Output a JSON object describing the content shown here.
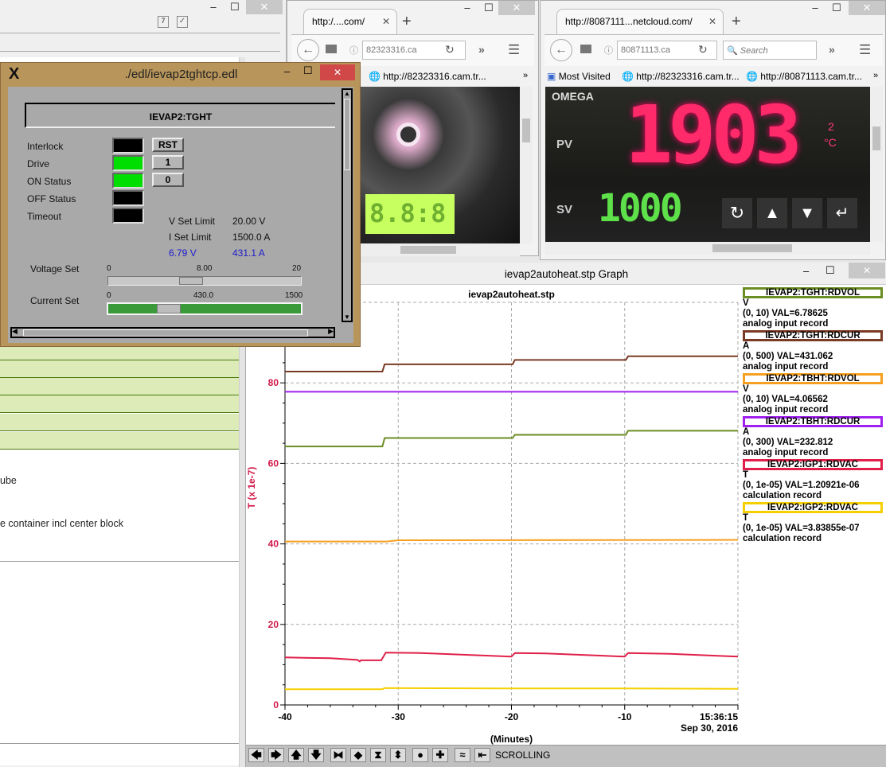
{
  "left_window": {
    "text_line_1": "ube",
    "text_line_2": "e container incl center block",
    "icons": [
      "calendar-icon",
      "task-check-icon"
    ]
  },
  "browser1": {
    "tab_title": "http:/....com/",
    "url": "82323316.ca",
    "bookmark": "http://82323316.cam.tr...",
    "overflow": "»",
    "lcd_text": "8.8:8"
  },
  "browser2": {
    "tab_title": "http://8087111...netcloud.com/",
    "url": "80871113.ca",
    "search_placeholder": "Search",
    "bookmarks": [
      "Most Visited",
      "http://82323316.cam.tr...",
      "http://80871113.cam.tr..."
    ],
    "overflow": "»",
    "display": {
      "brand": "OMEGA",
      "pv_label": "PV",
      "pv_value": "1903",
      "sv_label": "SV",
      "sv_value": "1000",
      "unit": "°C",
      "unit_index": "2"
    }
  },
  "edl": {
    "title": "./edl/ievap2tghtcp.edl",
    "header": "IEVAP2:TGHT",
    "indicators": [
      {
        "label": "Interlock",
        "color": "#000000"
      },
      {
        "label": "Drive",
        "color": "#00dd00"
      },
      {
        "label": "ON Status",
        "color": "#00dd00"
      },
      {
        "label": "OFF Status",
        "color": "#000000"
      },
      {
        "label": "Timeout",
        "color": "#000000"
      }
    ],
    "buttons": [
      "RST",
      "1",
      "0"
    ],
    "v_set_limit_label": "V Set Limit",
    "v_set_limit": "20.00 V",
    "i_set_limit_label": "I Set Limit",
    "i_set_limit": "1500.0 A",
    "v_readback": "6.79 V",
    "i_readback": "431.1 A",
    "voltage_set": {
      "label": "Voltage Set",
      "min": "0",
      "value": "8.00",
      "max": "20",
      "fraction": 0.4
    },
    "current_set": {
      "label": "Current Set",
      "min": "0",
      "value": "430.0",
      "max": "1500",
      "fraction": 0.287
    }
  },
  "graph": {
    "window_title": "ievap2autoheat.stp Graph",
    "status": "SCROLLING",
    "legend": [
      {
        "name": "IEVAP2:TGHT:RDVOL",
        "unit": "V",
        "range": "(0, 10) VAL=6.78625",
        "type": "analog input record",
        "color": "#6b8e23"
      },
      {
        "name": "IEVAP2:TGHT:RDCUR",
        "unit": "A",
        "range": "(0, 500) VAL=431.062",
        "type": "analog input record",
        "color": "#7a3b25"
      },
      {
        "name": "IEVAP2:TBHT:RDVOL",
        "unit": "V",
        "range": "(0, 10) VAL=4.06562",
        "type": "analog input record",
        "color": "#f5a020"
      },
      {
        "name": "IEVAP2:TBHT:RDCUR",
        "unit": "A",
        "range": "(0, 300) VAL=232.812",
        "type": "analog input record",
        "color": "#a020f0"
      },
      {
        "name": "IEVAP2:IGP1:RDVAC",
        "unit": "T",
        "range": "(0, 1e-05) VAL=1.20921e-06",
        "type": "calculation record",
        "color": "#e0204a"
      },
      {
        "name": "IEVAP2:IGP2:RDVAC",
        "unit": "T",
        "range": "(0, 1e-05) VAL=3.83855e-07",
        "type": "calculation record",
        "color": "#f5d000"
      }
    ],
    "toolbar_icons": [
      "pan-left-icon",
      "pan-right-icon",
      "pan-up-icon",
      "pan-down-icon",
      "zoom-in-x-icon",
      "zoom-out-x-icon",
      "zoom-in-y-icon",
      "zoom-out-y-icon",
      "reset-icon",
      "add-icon",
      "autoscale-icon",
      "scroll-end-icon"
    ]
  },
  "chart_data": {
    "type": "line",
    "title": "ievap2autoheat.stp",
    "xlabel": "(Minutes)",
    "ylabel": "T (x 1e-7)",
    "xlim": [
      -40,
      0
    ],
    "ylim": [
      0,
      100
    ],
    "xticks": [
      "-40",
      "-30",
      "-20",
      "-10"
    ],
    "xend_label": [
      "15:36:15",
      "Sep 30, 2016"
    ],
    "yticks": [
      "0",
      "20",
      "40",
      "60",
      "80"
    ],
    "grid": true,
    "legend_placement": "right",
    "series": [
      {
        "name": "IEVAP2:TGHT:RDVOL",
        "color": "#6b8e23",
        "x": [
          -40,
          -31.4,
          -31.2,
          -19.9,
          -19.7,
          -9.9,
          -9.7,
          0
        ],
        "y": [
          64.2,
          64.2,
          66.3,
          66.3,
          67.1,
          67.1,
          68.1,
          68.1
        ]
      },
      {
        "name": "IEVAP2:TGHT:RDCUR",
        "color": "#7a3b25",
        "x": [
          -40,
          -31.4,
          -31.2,
          -19.9,
          -19.7,
          -9.9,
          -9.7,
          0
        ],
        "y": [
          82.8,
          82.8,
          84.6,
          84.6,
          85.7,
          85.7,
          86.6,
          86.6
        ]
      },
      {
        "name": "IEVAP2:TBHT:RDVOL",
        "color": "#f5a020",
        "x": [
          -40,
          -31,
          -30,
          0
        ],
        "y": [
          40.6,
          40.6,
          40.9,
          41.0
        ]
      },
      {
        "name": "IEVAP2:TBHT:RDCUR",
        "color": "#a020f0",
        "x": [
          -40,
          0
        ],
        "y": [
          77.8,
          77.8
        ]
      },
      {
        "name": "IEVAP2:IGP1:RDVAC",
        "color": "#e0204a",
        "x": [
          -40,
          -36,
          -33.6,
          -33.4,
          -33.3,
          -31.5,
          -31.1,
          -28,
          -20,
          -19.7,
          -17,
          -10,
          -9.7,
          -6,
          0
        ],
        "y": [
          11.8,
          11.6,
          11.2,
          10.8,
          11.1,
          11.1,
          13.0,
          12.9,
          12.0,
          12.9,
          12.8,
          12.0,
          12.9,
          12.7,
          12.0
        ]
      },
      {
        "name": "IEVAP2:IGP2:RDVAC",
        "color": "#f5d000",
        "x": [
          -40,
          -31.4,
          -31.2,
          -20,
          -10,
          0
        ],
        "y": [
          3.9,
          3.9,
          4.2,
          4.1,
          4.1,
          4.0
        ]
      }
    ]
  }
}
